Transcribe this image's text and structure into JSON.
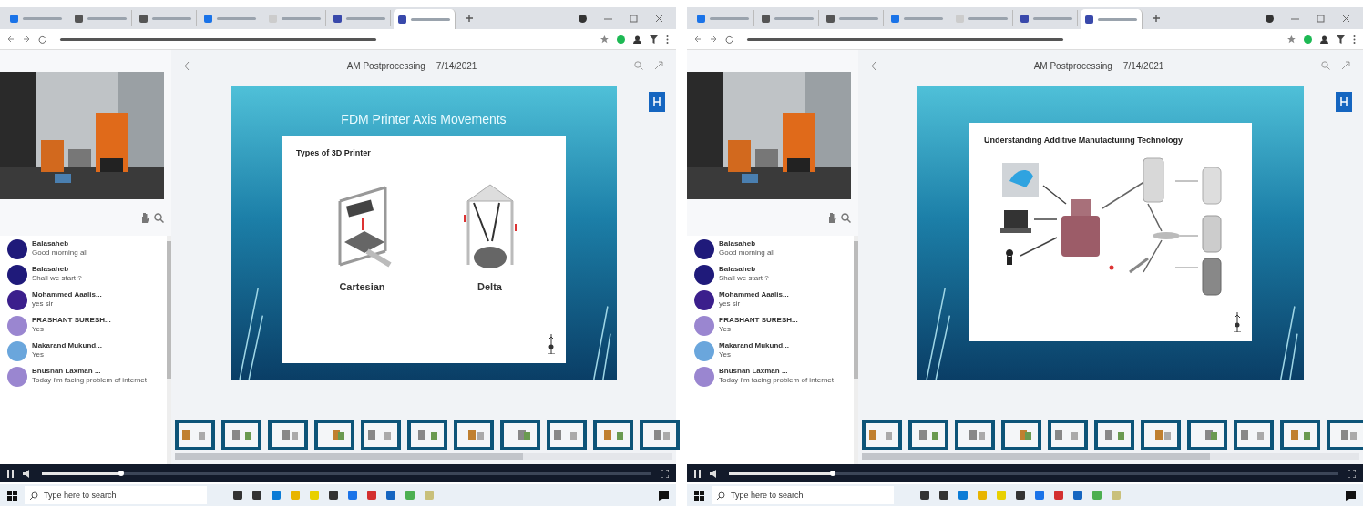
{
  "panes": [
    {
      "tabs": [
        {
          "selected": false
        },
        {
          "selected": false
        },
        {
          "selected": false
        },
        {
          "selected": false
        },
        {
          "selected": false
        },
        {
          "selected": false
        },
        {
          "selected": true
        }
      ],
      "header": {
        "title": "AM Postprocessing",
        "date": "7/14/2021"
      },
      "slide": {
        "kind": "printer-types",
        "title": "FDM Printer Axis Movements",
        "heading": "Types of 3D Printer",
        "labels": [
          "Cartesian",
          "Delta"
        ]
      },
      "chat": [
        {
          "name": "Balasaheb",
          "message": "Good morning all",
          "color": "#1f1a7a"
        },
        {
          "name": "Balasaheb",
          "message": "Shall we start ?",
          "color": "#1f1a7a"
        },
        {
          "name": "Mohammed Aaalis...",
          "message": "yes sir",
          "color": "#3b1f8c"
        },
        {
          "name": "PRASHANT SURESH...",
          "message": "Yes",
          "color": "#9a86d0"
        },
        {
          "name": "Makarand Mukund...",
          "message": "Yes",
          "color": "#6aa6dc"
        },
        {
          "name": "Bhushan Laxman ...",
          "message": "Today i'm facing problem of internet",
          "color": "#9a86d0"
        }
      ],
      "player": {
        "level": 0.13
      },
      "taskbar": {
        "search": "Type here to search"
      }
    },
    {
      "tabs": [
        {
          "selected": false
        },
        {
          "selected": false
        },
        {
          "selected": false
        },
        {
          "selected": false
        },
        {
          "selected": false
        },
        {
          "selected": false
        },
        {
          "selected": true
        }
      ],
      "header": {
        "title": "AM Postprocessing",
        "date": "7/14/2021"
      },
      "slide": {
        "kind": "am-technology",
        "heading": "Understanding Additive Manufacturing Technology"
      },
      "chat": [
        {
          "name": "Balasaheb",
          "message": "Good morning all",
          "color": "#1f1a7a"
        },
        {
          "name": "Balasaheb",
          "message": "Shall we start ?",
          "color": "#1f1a7a"
        },
        {
          "name": "Mohammed Aaalis...",
          "message": "yes sir",
          "color": "#3b1f8c"
        },
        {
          "name": "PRASHANT SURESH...",
          "message": "Yes",
          "color": "#9a86d0"
        },
        {
          "name": "Makarand Mukund...",
          "message": "Yes",
          "color": "#6aa6dc"
        },
        {
          "name": "Bhushan Laxman ...",
          "message": "Today i'm facing problem of internet",
          "color": "#9a86d0"
        }
      ],
      "player": {
        "level": 0.17
      },
      "taskbar": {
        "search": "Type here to search"
      }
    }
  ]
}
